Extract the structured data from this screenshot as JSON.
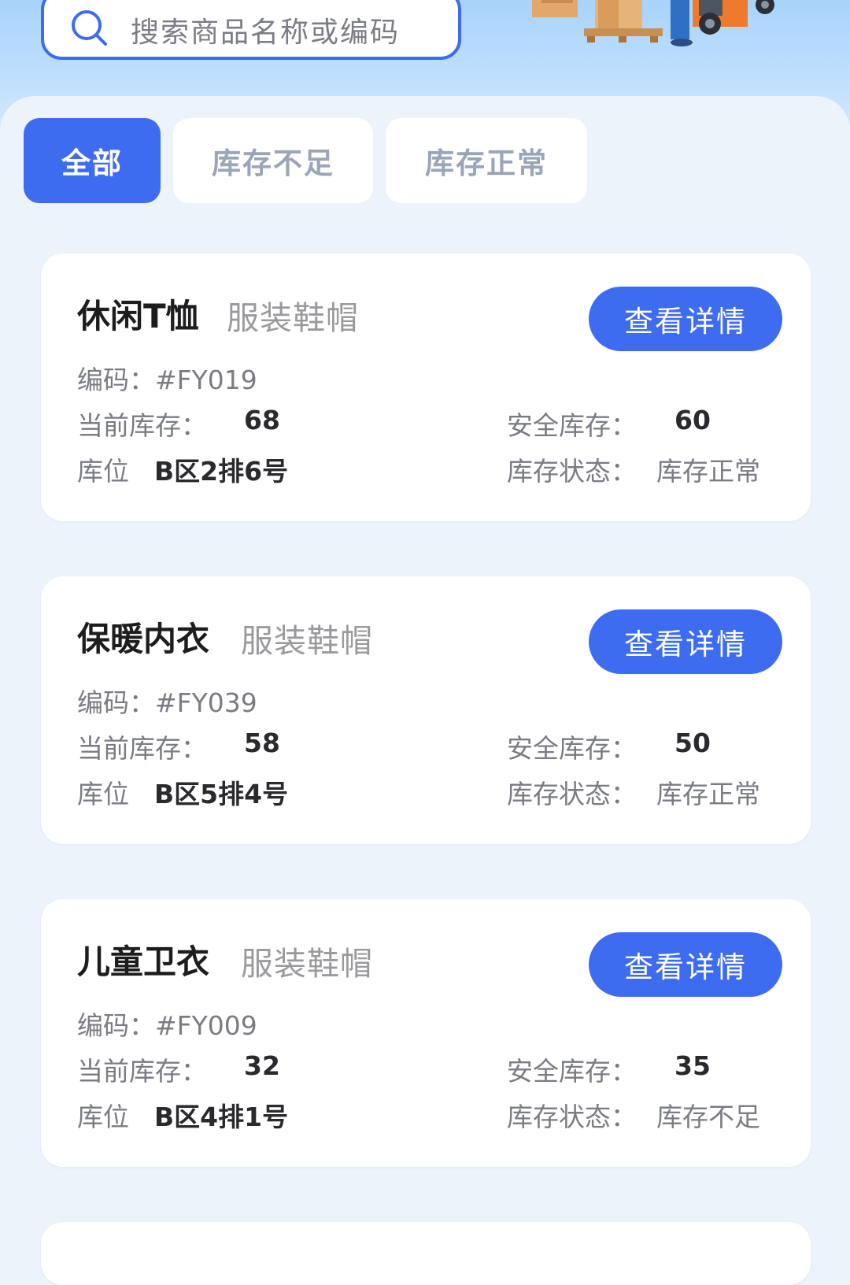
{
  "search": {
    "placeholder": "搜索商品名称或编码"
  },
  "tabs": [
    {
      "label": "全部",
      "active": true
    },
    {
      "label": "库存不足",
      "active": false
    },
    {
      "label": "库存正常",
      "active": false
    }
  ],
  "labels": {
    "code": "编码：",
    "current_stock": "当前库存：",
    "safety_stock": "安全库存：",
    "location": "库位",
    "status": "库存状态：",
    "detail_button": "查看详情"
  },
  "products": [
    {
      "name": "休闲T恤",
      "category": "服装鞋帽",
      "code": "#FY019",
      "current_stock": "68",
      "safety_stock": "60",
      "location": "B区2排6号",
      "status": "库存正常"
    },
    {
      "name": "保暖内衣",
      "category": "服装鞋帽",
      "code": "#FY039",
      "current_stock": "58",
      "safety_stock": "50",
      "location": "B区5排4号",
      "status": "库存正常"
    },
    {
      "name": "儿童卫衣",
      "category": "服装鞋帽",
      "code": "#FY009",
      "current_stock": "32",
      "safety_stock": "35",
      "location": "B区4排1号",
      "status": "库存不足"
    }
  ],
  "colors": {
    "accent": "#3e6cf0",
    "header_top": "#a9d3fb",
    "background": "#edf3fb"
  }
}
